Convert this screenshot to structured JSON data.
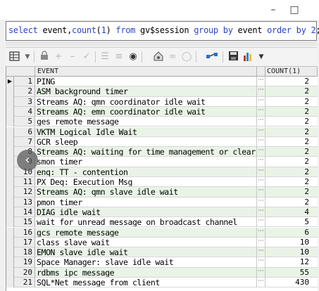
{
  "window": {
    "title": "",
    "minimize_icon": "minimize-icon",
    "maximize_icon": "maximize-icon"
  },
  "editor": {
    "sql_tokens": [
      {
        "text": "select",
        "kind": "kw"
      },
      {
        "text": " event,",
        "kind": "tx"
      },
      {
        "text": "count",
        "kind": "kw"
      },
      {
        "text": "(",
        "kind": "tx"
      },
      {
        "text": "1",
        "kind": "num"
      },
      {
        "text": ") ",
        "kind": "tx"
      },
      {
        "text": "from",
        "kind": "kw"
      },
      {
        "text": " gv$session ",
        "kind": "tx"
      },
      {
        "text": "group by",
        "kind": "kw"
      },
      {
        "text": " event ",
        "kind": "tx"
      },
      {
        "text": "order by",
        "kind": "kw"
      },
      {
        "text": " ",
        "kind": "tx"
      },
      {
        "text": "2",
        "kind": "num"
      },
      {
        "text": ";",
        "kind": "tx"
      }
    ]
  },
  "toolbar": {
    "icons": [
      "grid-view-icon",
      "lock-icon",
      "add-row-icon",
      "delete-row-icon",
      "post-icon",
      "filter-icon",
      "query-by-example-icon",
      "find-icon",
      "home-icon",
      "link-icon",
      "clear-icon",
      "connect-icon",
      "save-icon",
      "export-icon"
    ]
  },
  "grid": {
    "columns": [
      "EVENT",
      "COUNT(1)"
    ],
    "current_row_marker": "▶",
    "cell_button": "···",
    "rows": [
      {
        "n": "1",
        "event": "PING",
        "count": "2"
      },
      {
        "n": "2",
        "event": "ASM background timer",
        "count": "2"
      },
      {
        "n": "3",
        "event": "Streams AQ: qmn coordinator idle wait",
        "count": "2"
      },
      {
        "n": "4",
        "event": "Streams AQ: emn coordinator idle wait",
        "count": "2"
      },
      {
        "n": "5",
        "event": "ges remote message",
        "count": "2"
      },
      {
        "n": "6",
        "event": "VKTM Logical Idle Wait",
        "count": "2"
      },
      {
        "n": "7",
        "event": "GCR sleep",
        "count": "2"
      },
      {
        "n": "8",
        "event": "Streams AQ: waiting for time management or clear",
        "count": "2"
      },
      {
        "n": "9",
        "event": "smon timer",
        "count": "2"
      },
      {
        "n": "10",
        "event": "enq: TT - contention",
        "count": "2"
      },
      {
        "n": "11",
        "event": "PX Deq: Execution Msg",
        "count": "2"
      },
      {
        "n": "12",
        "event": "Streams AQ: qmn slave idle wait",
        "count": "2"
      },
      {
        "n": "13",
        "event": "pmon timer",
        "count": "2"
      },
      {
        "n": "14",
        "event": "DIAG idle wait",
        "count": "4"
      },
      {
        "n": "15",
        "event": "wait for unread message on broadcast channel",
        "count": "5"
      },
      {
        "n": "16",
        "event": "gcs remote message",
        "count": "6"
      },
      {
        "n": "17",
        "event": "class slave wait",
        "count": "10"
      },
      {
        "n": "18",
        "event": "EMON slave idle wait",
        "count": "10"
      },
      {
        "n": "19",
        "event": "Space Manager: slave idle wait",
        "count": "12"
      },
      {
        "n": "20",
        "event": "rdbms ipc message",
        "count": "55"
      },
      {
        "n": "21",
        "event": "SQL*Net message from client",
        "count": "430"
      }
    ]
  },
  "overlay": {
    "prev_icon": "chevron-left-icon"
  }
}
